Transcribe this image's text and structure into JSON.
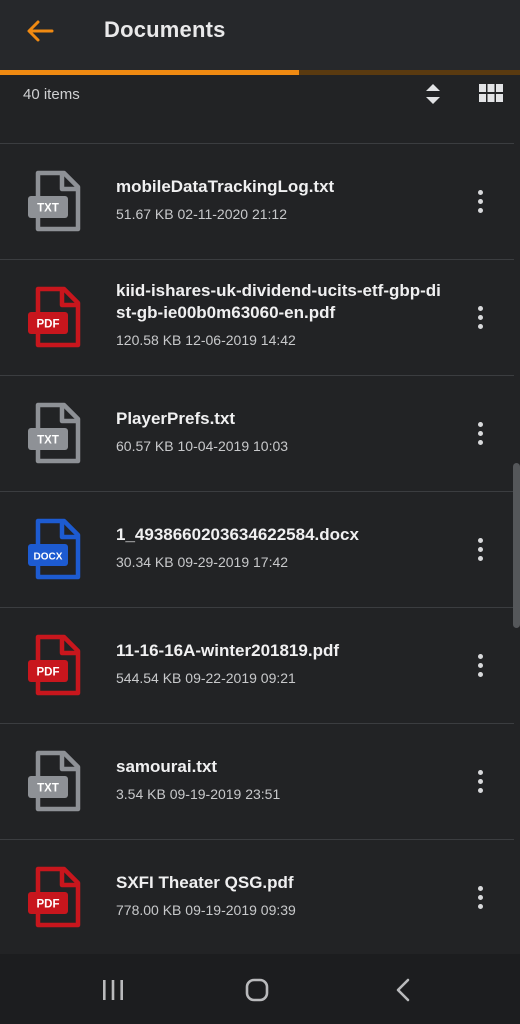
{
  "header": {
    "title": "Documents",
    "progress_fraction": 0.575
  },
  "toolbar": {
    "item_count": "40 items"
  },
  "files": [
    {
      "name": "mobileDataTrackingLog.txt",
      "size": "51.67 KB",
      "date": "02-11-2020 21:12",
      "type": "TXT"
    },
    {
      "name": "kiid-ishares-uk-dividend-ucits-etf-gbp-dist-gb-ie00b0m63060-en.pdf",
      "size": "120.58 KB",
      "date": "12-06-2019 14:42",
      "type": "PDF"
    },
    {
      "name": "PlayerPrefs.txt",
      "size": "60.57 KB",
      "date": "10-04-2019 10:03",
      "type": "TXT"
    },
    {
      "name": "1_4938660203634622584.docx",
      "size": "30.34 KB",
      "date": "09-29-2019 17:42",
      "type": "DOCX"
    },
    {
      "name": "11-16-16A-winter201819.pdf",
      "size": "544.54 KB",
      "date": "09-22-2019 09:21",
      "type": "PDF"
    },
    {
      "name": "samourai.txt",
      "size": "3.54 KB",
      "date": "09-19-2019 23:51",
      "type": "TXT"
    },
    {
      "name": "SXFI Theater QSG.pdf",
      "size": "778.00 KB",
      "date": "09-19-2019 09:39",
      "type": "PDF"
    }
  ],
  "colors": {
    "accent": "#f08a12",
    "txt": "#8e9196",
    "pdf": "#c8161d",
    "docx": "#1d5bd1"
  },
  "icons": {
    "back": "arrow-left-icon",
    "sort": "sort-icon",
    "view": "grid-view-icon",
    "more": "more-vertical-icon",
    "nav_recents": "recents-icon",
    "nav_home": "home-icon",
    "nav_back": "chevron-left-icon"
  }
}
